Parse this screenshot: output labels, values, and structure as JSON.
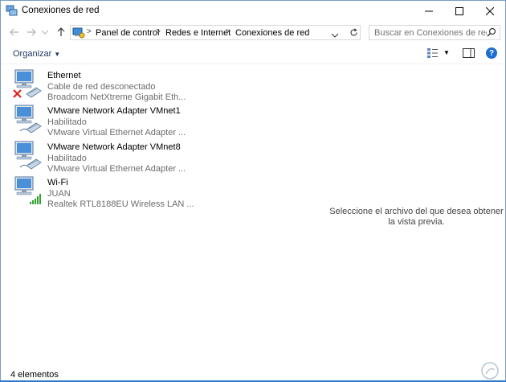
{
  "window": {
    "title": "Conexiones de red"
  },
  "address": {
    "crumbs": [
      "Panel de control",
      "Redes e Internet",
      "Conexiones de red"
    ],
    "separator": ">"
  },
  "search": {
    "placeholder": "Buscar en Conexiones de red"
  },
  "toolbar": {
    "organize_label": "Organizar",
    "help_label": "?"
  },
  "connections": [
    {
      "name": "Ethernet",
      "status": "Cable de red desconectado",
      "device": "Broadcom NetXtreme Gigabit Eth...",
      "state_icon": "disconnected-x-icon"
    },
    {
      "name": "VMware Network Adapter VMnet1",
      "status": "Habilitado",
      "device": "VMware Virtual Ethernet Adapter ...",
      "state_icon": "cable-icon"
    },
    {
      "name": "VMware Network Adapter VMnet8",
      "status": "Habilitado",
      "device": "VMware Virtual Ethernet Adapter ...",
      "state_icon": "cable-icon"
    },
    {
      "name": "Wi-Fi",
      "status": "JUAN",
      "device": "Realtek RTL8188EU Wireless LAN ...",
      "state_icon": "wifi-signal-icon"
    }
  ],
  "preview_text": "Seleccione el archivo del que desea obtener la vista previa.",
  "status_bar": {
    "count": "4 elementos"
  },
  "colors": {
    "accent": "#2b79d0",
    "help": "#1c6fd0",
    "error": "#d9251d",
    "signal": "#2fa52f"
  }
}
